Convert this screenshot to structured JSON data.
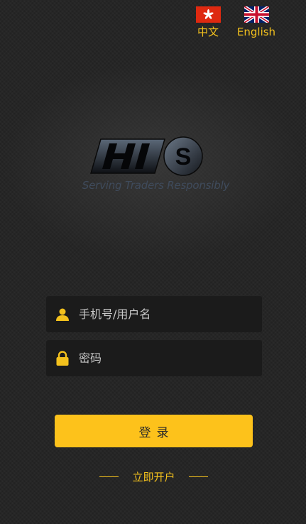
{
  "languages": {
    "zh": {
      "label": "中文",
      "flag": "hong-kong-flag-icon"
    },
    "en": {
      "label": "English",
      "flag": "uk-flag-icon"
    }
  },
  "logo": {
    "brand": "HIS",
    "tagline": "Serving Traders Responsibly"
  },
  "form": {
    "username_placeholder": "手机号/用户名",
    "password_placeholder": "密码",
    "login_label": "登录",
    "register_label": "立即开户"
  },
  "colors": {
    "accent": "#fdc21b",
    "background": "#242424",
    "field_background": "#1b1b1b"
  }
}
